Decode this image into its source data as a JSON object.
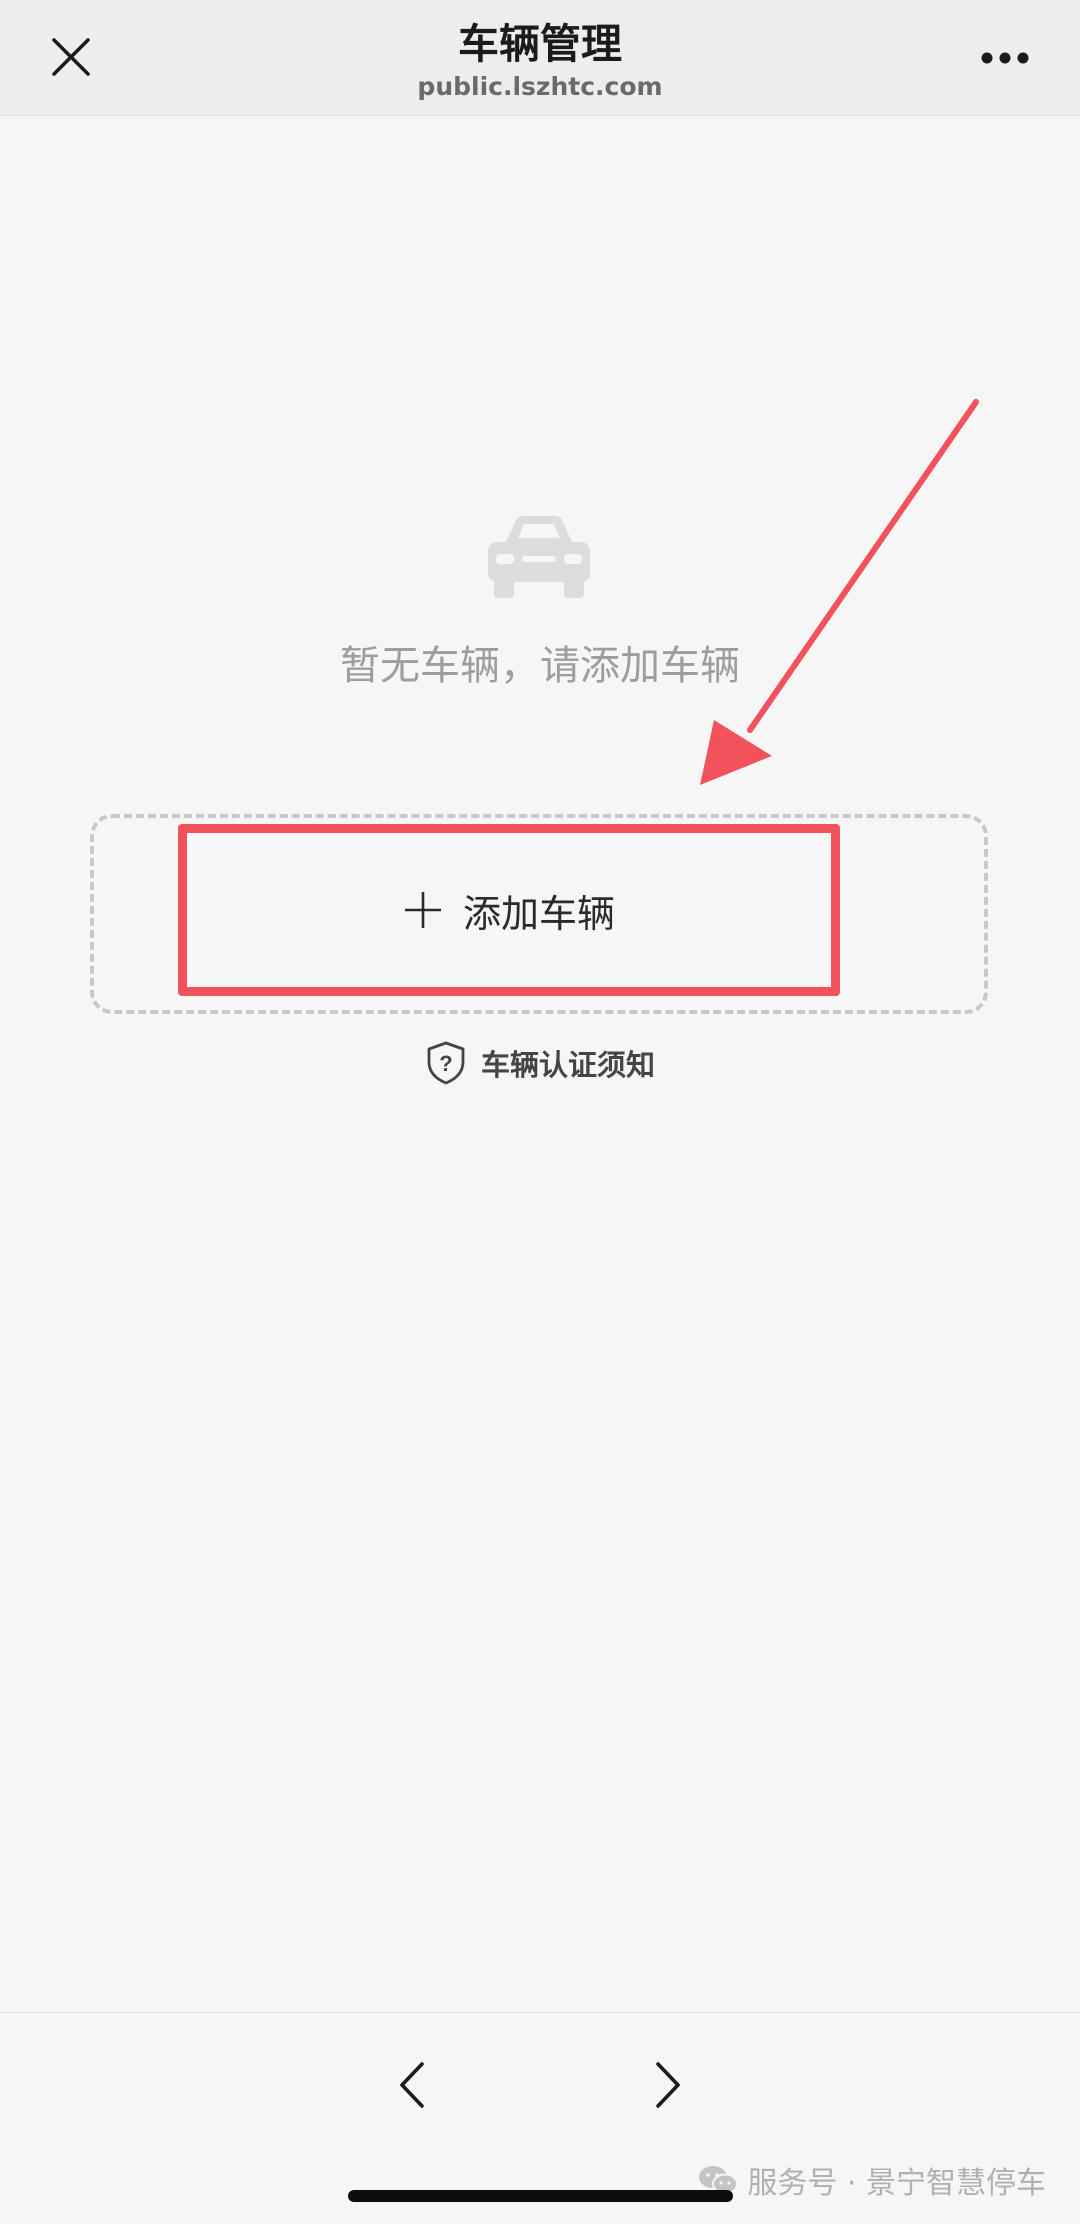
{
  "header": {
    "title": "车辆管理",
    "subtitle": "public.lszhtc.com",
    "close_icon": "close-icon",
    "more_icon": "more-icon"
  },
  "empty_state": {
    "icon": "car-icon",
    "message": "暂无车辆，请添加车辆"
  },
  "add_vehicle": {
    "label": "添加车辆",
    "icon": "plus-icon"
  },
  "notice": {
    "label": "车辆认证须知",
    "icon": "shield-question-icon"
  },
  "bottom_nav": {
    "back_icon": "chevron-left-icon",
    "forward_icon": "chevron-right-icon"
  },
  "watermark": {
    "icon": "wechat-icon",
    "text": "服务号 · 景宁智慧停车"
  },
  "colors": {
    "highlight": "#f2525b",
    "arrow": "#f2525b",
    "background": "#f6f6f6"
  }
}
